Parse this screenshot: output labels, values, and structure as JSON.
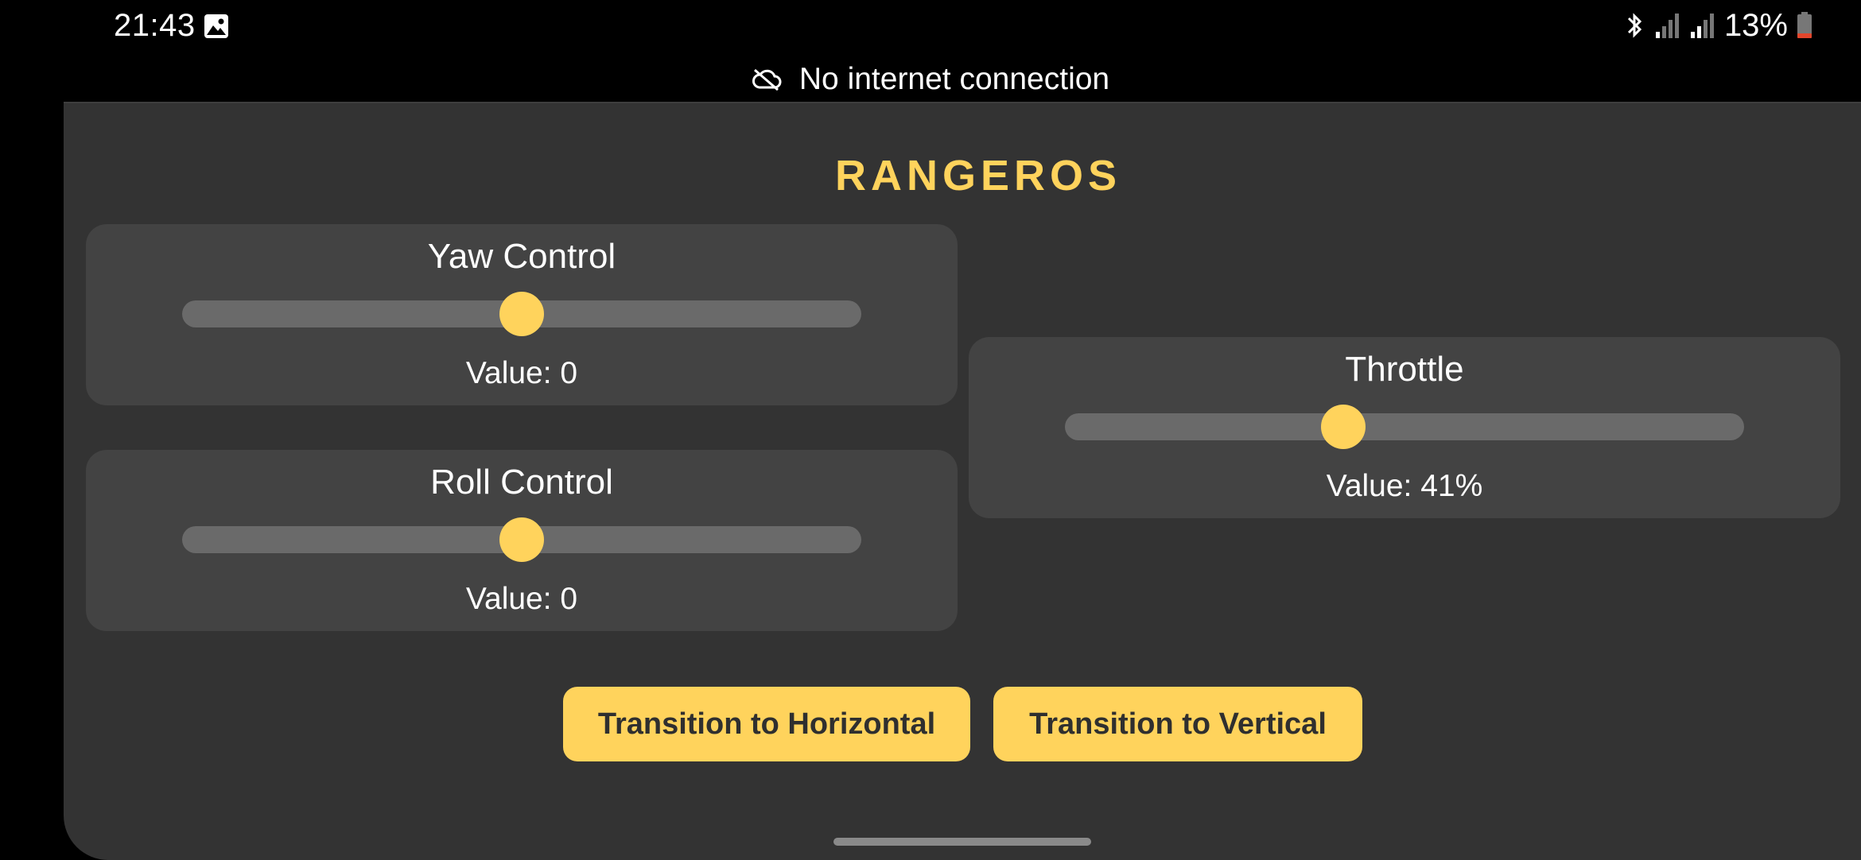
{
  "status_bar": {
    "time": "21:43",
    "battery_percent_label": "13%",
    "icons": [
      "gallery-icon",
      "bluetooth-icon",
      "signal-icon",
      "signal-icon",
      "battery-icon"
    ]
  },
  "network_banner": {
    "icon": "cloud-off-icon",
    "text": "No internet connection"
  },
  "app": {
    "title": "RANGEROS",
    "accent_color": "#ffd35c",
    "controls": {
      "yaw": {
        "label": "Yaw Control",
        "value_text": "Value: 0",
        "level": 0.5
      },
      "roll": {
        "label": "Roll Control",
        "value_text": "Value: 0",
        "level": 0.5
      },
      "throttle": {
        "label": "Throttle",
        "value_text": "Value: 41%",
        "level": 0.41
      }
    },
    "buttons": {
      "horizontal": "Transition to Horizontal",
      "vertical": "Transition to Vertical"
    }
  }
}
